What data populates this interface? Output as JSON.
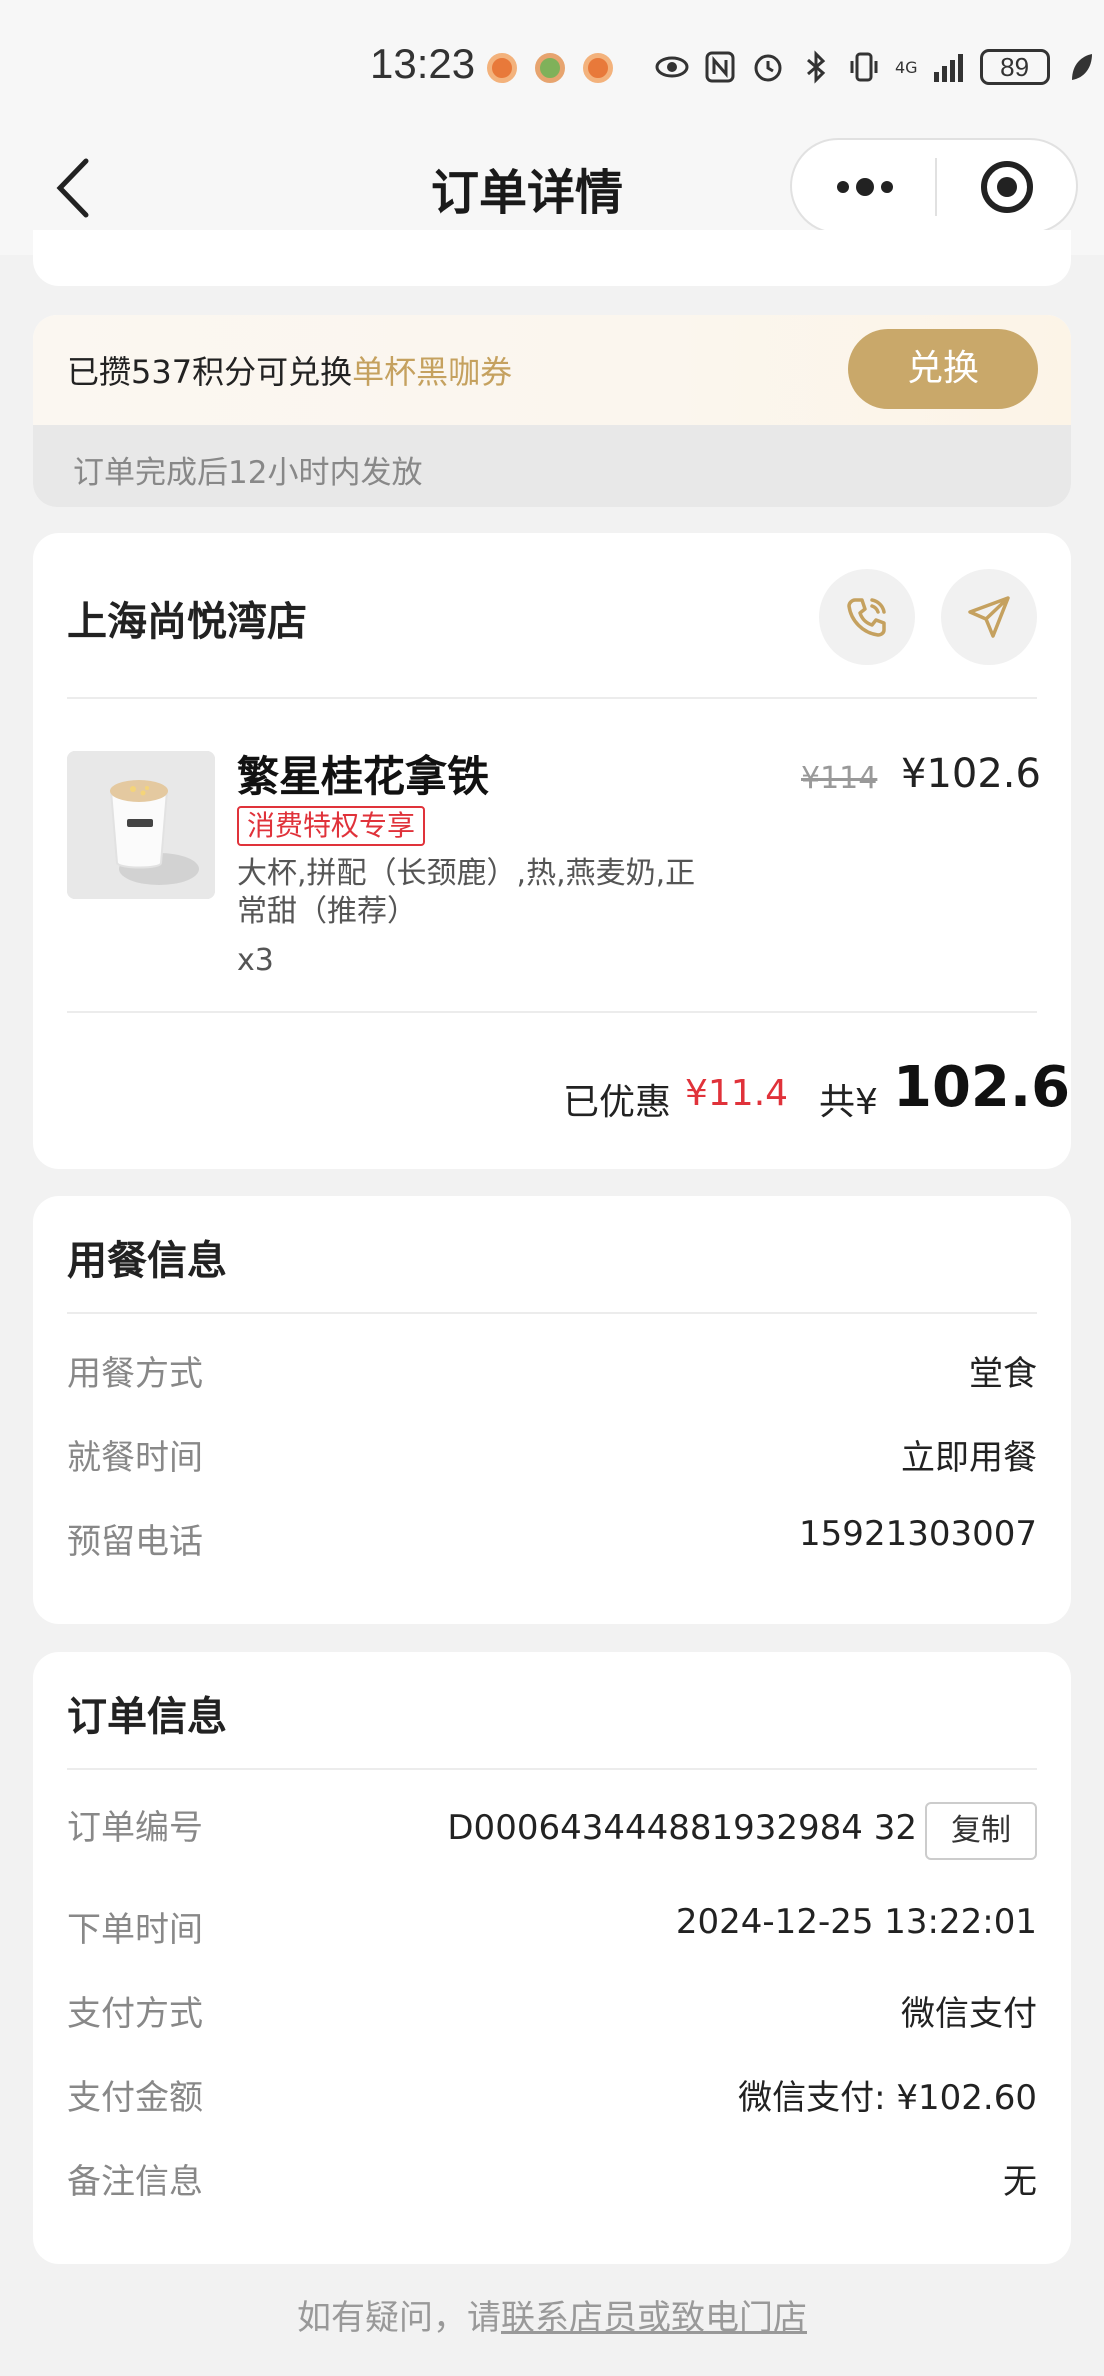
{
  "status_bar": {
    "time": "13:23",
    "battery": "89",
    "network": "4G"
  },
  "nav": {
    "title": "订单详情"
  },
  "points": {
    "prefix": "已攒537积分可兑换",
    "highlight": "单杯黑咖券",
    "button": "兑换",
    "note": "订单完成后12小时内发放"
  },
  "store": {
    "name": "上海尚悦湾店",
    "product": {
      "name": "繁星桂花拿铁",
      "tag": "消费特权专享",
      "spec": "大杯,拼配（长颈鹿）,热,燕麦奶,正常甜（推荐）",
      "quantity": "x3",
      "original_price": "¥114",
      "price": "¥102.6"
    },
    "discount_label": "已优惠",
    "discount_value": "¥11.4",
    "total_label": "共¥",
    "total_value": "102.6"
  },
  "dining": {
    "title": "用餐信息",
    "rows": [
      {
        "label": "用餐方式",
        "value": "堂食"
      },
      {
        "label": "就餐时间",
        "value": "立即用餐"
      },
      {
        "label": "预留电话",
        "value": "15921303007"
      }
    ]
  },
  "order": {
    "title": "订单信息",
    "copy_label": "复制",
    "rows": [
      {
        "label": "订单编号",
        "value": "D000643444881932984 32"
      },
      {
        "label": "下单时间",
        "value": "2024-12-25 13:22:01"
      },
      {
        "label": "支付方式",
        "value": "微信支付"
      },
      {
        "label": "支付金额",
        "value": "微信支付: ¥102.60"
      },
      {
        "label": "备注信息",
        "value": "无"
      }
    ]
  },
  "footer": {
    "prefix": "如有疑问，请",
    "link": "联系店员或致电门店"
  },
  "colors": {
    "accent_gold": "#c9a86a",
    "discount_red": "#e0323a"
  }
}
